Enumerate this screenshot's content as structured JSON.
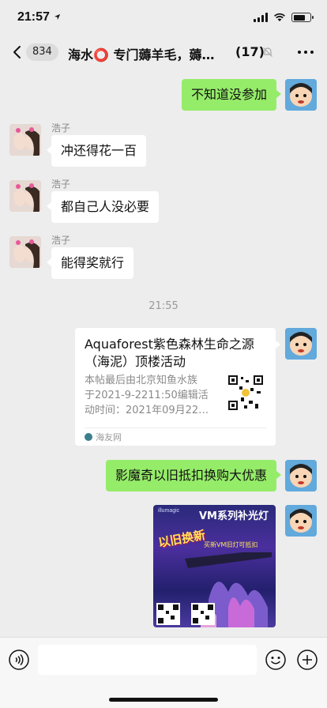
{
  "status": {
    "time": "21:57",
    "location_arrow": "location-arrow-icon"
  },
  "nav": {
    "unread_count": "834",
    "title": "海水⭕ 专门薅羊毛，薅…",
    "member_count": "(17)"
  },
  "messages": [
    {
      "sender": "self",
      "text": "不知道没参加"
    },
    {
      "sender": "浩子",
      "text": "冲还得花一百"
    },
    {
      "sender": "浩子",
      "text": "都自己人没必要"
    },
    {
      "sender": "浩子",
      "text": "能得奖就行"
    }
  ],
  "timestamp": "21:55",
  "link_card": {
    "title": "Aquaforest紫色森林生命之源（海泥）顶楼活动",
    "description": "本帖最后由北京知鱼水族\n于2021-9-2211:50编辑活\n动时间：2021年09月22…",
    "source": "海友网"
  },
  "self_message_2": "影魔奇以旧抵扣换购大优惠",
  "poster": {
    "brand": "illumagic",
    "title": "VM系列补光灯",
    "badge": "以旧换新",
    "promo": "买新VM旧灯可抵扣"
  },
  "input": {
    "placeholder": ""
  },
  "colors": {
    "self_bubble": "#95ec69",
    "other_bubble": "#ffffff",
    "background": "#ededed"
  }
}
